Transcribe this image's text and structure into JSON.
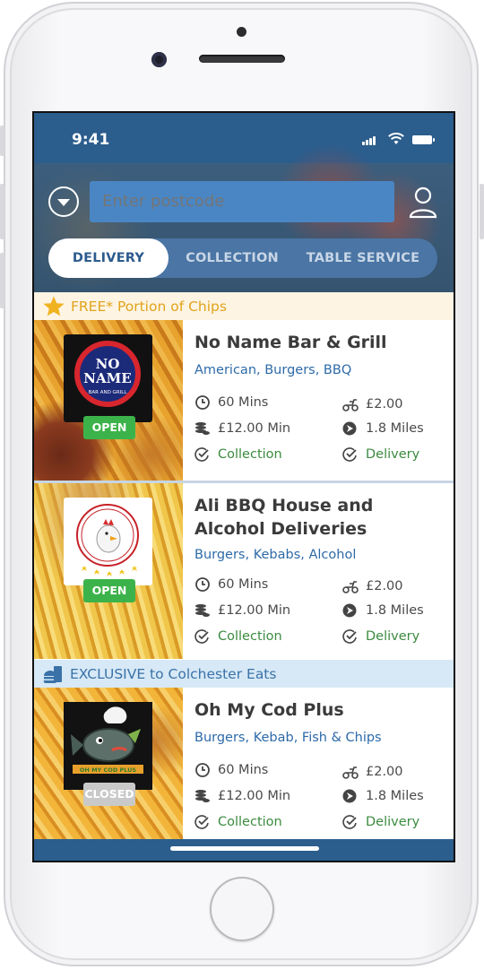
{
  "status_bar": {
    "time": "9:41"
  },
  "search": {
    "placeholder": "Enter postcode"
  },
  "tabs": [
    {
      "label": "DELIVERY",
      "active": true
    },
    {
      "label": "COLLECTION",
      "active": false
    },
    {
      "label": "TABLE SERVICE",
      "active": false
    }
  ],
  "promos": {
    "chips": {
      "text": "FREE* Portion of Chips",
      "icon": "star-icon"
    },
    "exclusive": {
      "text": "EXCLUSIVE to Colchester Eats",
      "icon": "food-icon"
    }
  },
  "restaurants": [
    {
      "name": "No Name Bar & Grill",
      "cuisine": "American, Burgers, BBQ",
      "status": "OPEN",
      "logo_text": [
        "NO",
        "NAME",
        "BAR AND GRILL"
      ],
      "time": "60 Mins",
      "delivery_fee": "£2.00",
      "min_order": "£12.00 Min",
      "distance": "1.8 Miles",
      "collection": "Collection",
      "delivery": "Delivery"
    },
    {
      "name": "Ali BBQ House and Alcohol Deliveries",
      "cuisine": "Burgers, Kebabs, Alcohol",
      "status": "OPEN",
      "time": "60 Mins",
      "delivery_fee": "£2.00",
      "min_order": "£12.00 Min",
      "distance": "1.8 Miles",
      "collection": "Collection",
      "delivery": "Delivery"
    },
    {
      "name": "Oh My Cod Plus",
      "cuisine": "Burgers, Kebab, Fish & Chips",
      "status": "CLOSED",
      "logo_text": [
        "OH MY COD PLUS"
      ],
      "time": "60 Mins",
      "delivery_fee": "£2.00",
      "min_order": "£12.00 Min",
      "distance": "1.8 Miles",
      "collection": "Collection",
      "delivery": "Delivery"
    }
  ],
  "colors": {
    "brand_blue": "#2b5d8d",
    "open_green": "#3cb34a",
    "closed_grey": "#bdbdbd",
    "promo_gold": "#e1a31b"
  }
}
